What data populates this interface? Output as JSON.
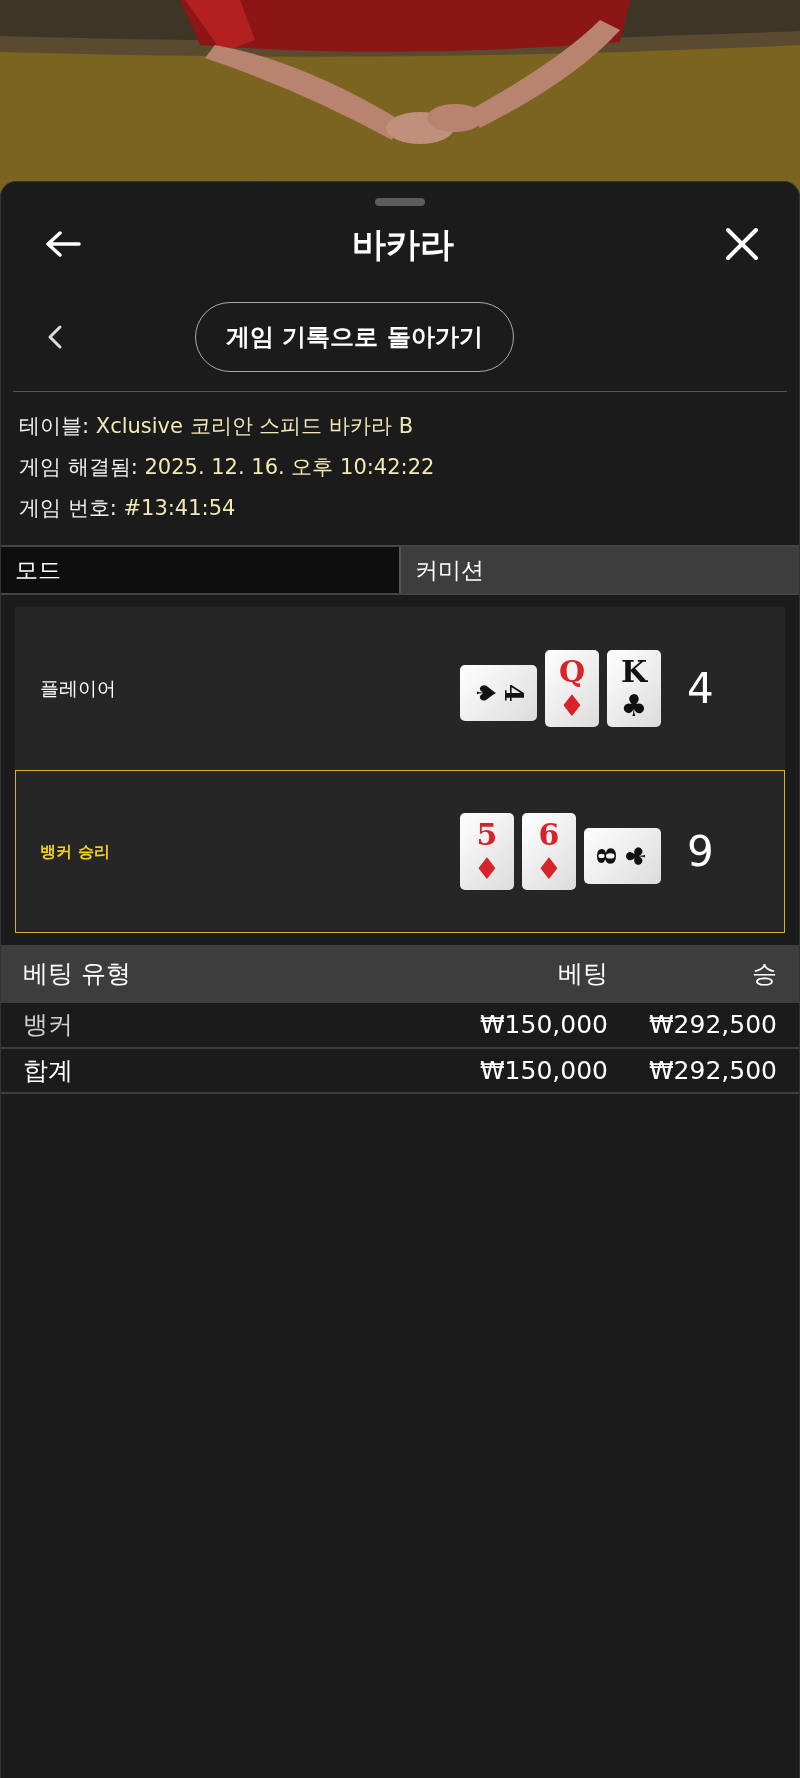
{
  "header": {
    "title": "바카라"
  },
  "back_to_history": {
    "label": "게임 기록으로 돌아가기"
  },
  "info": [
    {
      "label": "테이블:",
      "value": "Xclusive 코리안 스피드 바카라 B"
    },
    {
      "label": "게임 해결됨:",
      "value": "2025. 12. 16. 오후 10:42:22"
    },
    {
      "label": "게임 번호:",
      "value": "#13:41:54"
    }
  ],
  "tabs": [
    {
      "label": "모드",
      "selected": true
    },
    {
      "label": "커미션",
      "selected": false
    }
  ],
  "hands": [
    {
      "label": "플레이어",
      "winner": false,
      "score": "4",
      "cards": [
        {
          "rank": "4",
          "suit": "♠",
          "color": "#111111",
          "kind": "sideways-cw"
        },
        {
          "rank": "Q",
          "suit": "♦",
          "color": "#d8232a"
        },
        {
          "rank": "K",
          "suit": "♣",
          "color": "#111111"
        }
      ]
    },
    {
      "label": "뱅커 승리",
      "winner": true,
      "score": "9",
      "cards": [
        {
          "rank": "5",
          "suit": "♦",
          "color": "#d8232a"
        },
        {
          "rank": "6",
          "suit": "♦",
          "color": "#d8232a"
        },
        {
          "rank": "8",
          "suit": "♣",
          "color": "#111111",
          "kind": "sideways-ccw"
        }
      ]
    }
  ],
  "bets_table": {
    "columns": [
      "베팅 유형",
      "베팅",
      "승"
    ],
    "rows": [
      {
        "kind": "bet",
        "cells": [
          "뱅커",
          "₩150,000",
          "₩292,500"
        ]
      },
      {
        "kind": "total",
        "cells": [
          "합계",
          "₩150,000",
          "₩292,500"
        ]
      }
    ]
  }
}
